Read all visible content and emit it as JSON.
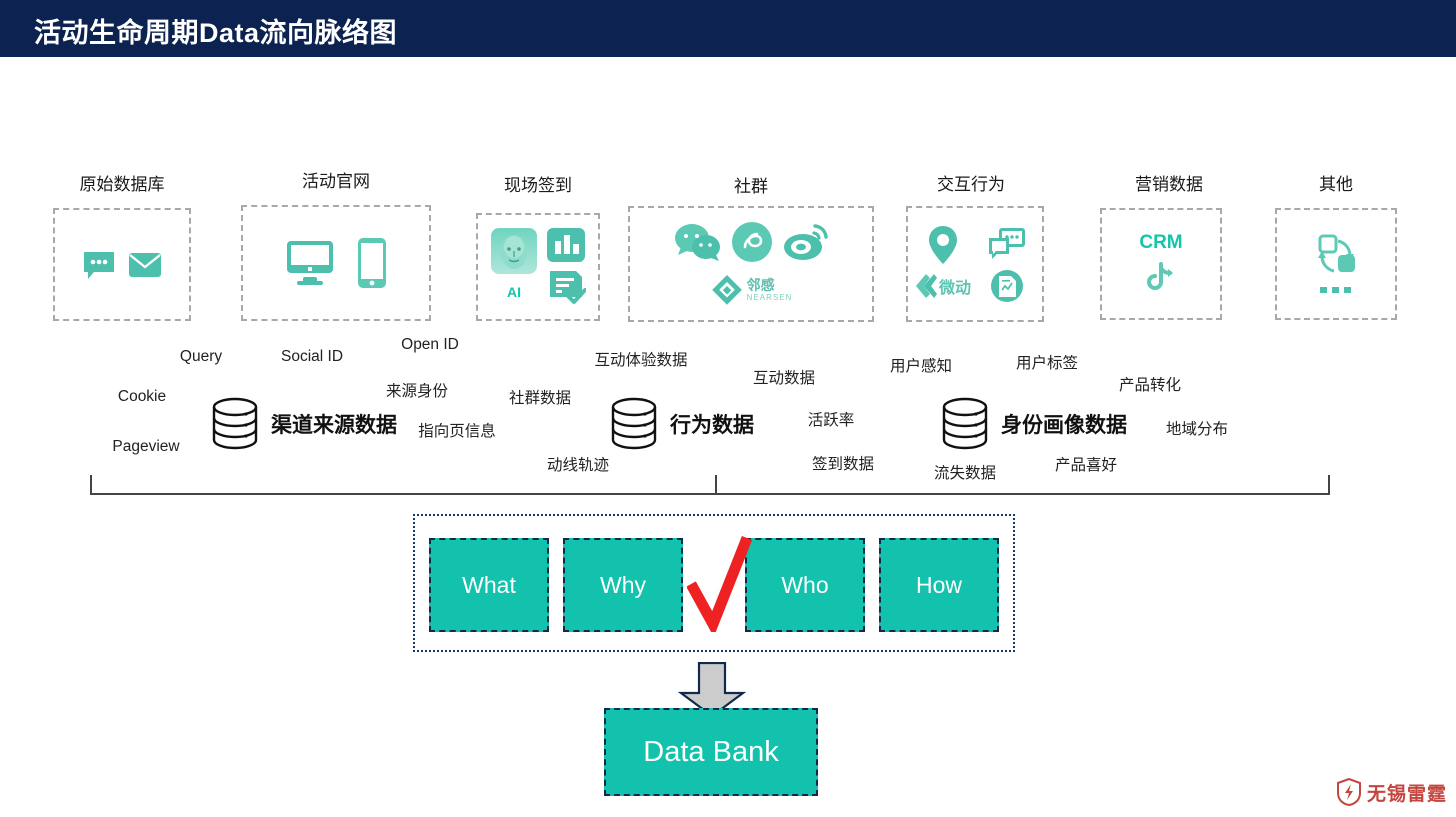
{
  "header": {
    "title": "活动生命周期Data流向脉络图",
    "bg_color": "#0c2250"
  },
  "colors": {
    "accent_teal": "#13c2ac",
    "icon_teal": "#4dbfad",
    "navy": "#13294b",
    "dashed_gray": "#a8a8a8",
    "check_red": "#ee2222",
    "arrow_gray": "#cccccc"
  },
  "sources": [
    {
      "label": "原始数据库",
      "icons": [
        "chat-bubble-icon",
        "envelope-icon"
      ]
    },
    {
      "label": "活动官网",
      "icons": [
        "desktop-monitor-icon",
        "mobile-phone-icon"
      ]
    },
    {
      "label": "现场签到",
      "icons": [
        "ai-face-recognition-icon",
        "bar-chart-icon",
        "document-check-icon"
      ],
      "badge": "AI"
    },
    {
      "label": "社群",
      "icons": [
        "wechat-icon",
        "wechat-miniprogram-icon",
        "weibo-icon",
        "nearsen-logo-icon"
      ],
      "brand": "邻感",
      "brand_sub": "NEARSEN"
    },
    {
      "label": "交互行为",
      "icons": [
        "location-pin-icon",
        "chat-bubbles-icon",
        "weidong-logo-icon",
        "document-chart-icon"
      ],
      "brand": "微动"
    },
    {
      "label": "营销数据",
      "icons": [
        "douyin-icon"
      ],
      "badge": "CRM"
    },
    {
      "label": "其他",
      "icons": [
        "sync-arrows-icon",
        "ellipsis-icon"
      ]
    }
  ],
  "clusters": [
    {
      "title": "渠道来源数据",
      "icon": "database-cylinder-icon",
      "keywords": [
        "Query",
        "Social ID",
        "Open ID",
        "Cookie",
        "Pageview",
        "来源身份",
        "指向页信息"
      ]
    },
    {
      "title": "行为数据",
      "icon": "database-cylinder-icon",
      "keywords": [
        "互动体验数据",
        "社群数据",
        "动线轨迹",
        "互动数据",
        "活跃率",
        "签到数据"
      ]
    },
    {
      "title": "身份画像数据",
      "icon": "database-cylinder-icon",
      "keywords": [
        "用户感知",
        "用户标签",
        "产品转化",
        "地域分布",
        "流失数据",
        "产品喜好"
      ]
    }
  ],
  "w_boxes": [
    {
      "label": "What"
    },
    {
      "label": "Why"
    },
    {
      "label": "Who"
    },
    {
      "label": "How"
    }
  ],
  "check_mark": {
    "symbol": "√"
  },
  "data_bank": {
    "label": "Data Bank"
  },
  "watermark": {
    "text": "无锡雷霆",
    "logo": "shield-lightning-icon"
  }
}
